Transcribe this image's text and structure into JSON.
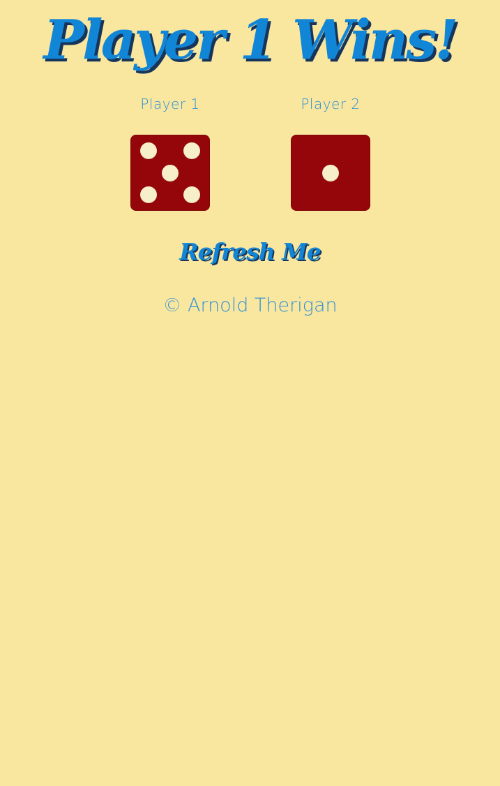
{
  "header": {
    "title": "Player 1 Wins!"
  },
  "players": [
    {
      "label": "Player 1",
      "die_value": 5
    },
    {
      "label": "Player 2",
      "die_value": 1
    }
  ],
  "actions": {
    "refresh_label": "Refresh Me"
  },
  "footer": {
    "credit": "© Arnold Therigan"
  },
  "colors": {
    "background": "#F9E7A0",
    "title_blue": "#1286D6",
    "title_shadow": "#17355A",
    "die_red": "#95060A",
    "pip_cream": "#F7EFC9"
  }
}
